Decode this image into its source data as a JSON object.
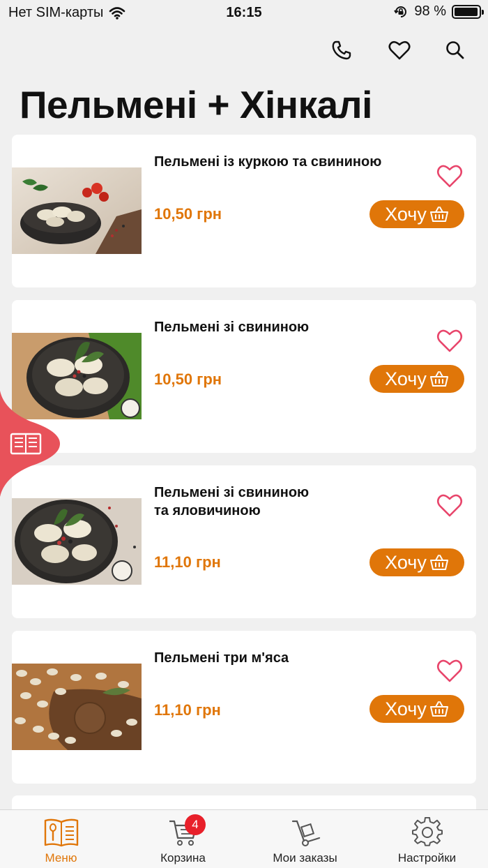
{
  "status_bar": {
    "carrier": "Нет SIM-карты",
    "time": "16:15",
    "battery": "98 %",
    "battery_level": 0.98
  },
  "header": {
    "title": "Пельмені + Хінкалі",
    "actions": [
      {
        "name": "phone-button",
        "icon": "phone-icon"
      },
      {
        "name": "favorites-button",
        "icon": "heart-icon"
      },
      {
        "name": "search-button",
        "icon": "search-icon"
      }
    ]
  },
  "products": [
    {
      "name": "Пельмені із куркою та свининою",
      "price": "10,50 грн",
      "button_label": "Хочу"
    },
    {
      "name": "Пельмені зі свининою",
      "price": "10,50 грн",
      "button_label": "Хочу"
    },
    {
      "name": "Пельмені зі свининою\nта яловичиною",
      "price": "11,10 грн",
      "button_label": "Хочу"
    },
    {
      "name": "Пельмені три м'яса",
      "price": "11,10 грн",
      "button_label": "Хочу"
    }
  ],
  "tabbar": {
    "items": [
      {
        "label": "Меню",
        "icon": "menu-book-icon",
        "active": true
      },
      {
        "label": "Корзина",
        "icon": "cart-icon",
        "badge": "4"
      },
      {
        "label": "Мои заказы",
        "icon": "hand-truck-icon"
      },
      {
        "label": "Настройки",
        "icon": "gear-icon"
      }
    ]
  },
  "colors": {
    "accent": "#e07609",
    "heart": "#e8456b",
    "side_tab": "#e8525a",
    "badge": "#e8202a",
    "background": "#f0f0f0"
  }
}
